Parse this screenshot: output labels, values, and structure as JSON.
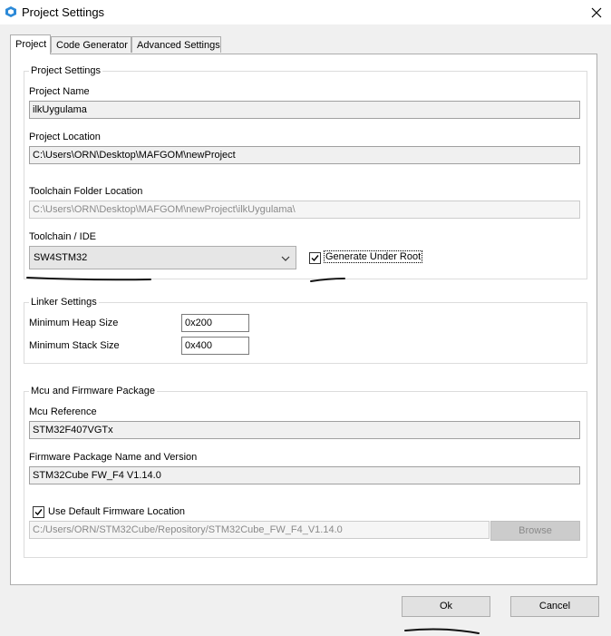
{
  "window": {
    "title": "Project Settings",
    "icon": "app-cube-icon"
  },
  "tabs": [
    {
      "label": "Project",
      "active": true
    },
    {
      "label": "Code Generator",
      "active": false
    },
    {
      "label": "Advanced Settings",
      "active": false
    }
  ],
  "project_settings": {
    "group_label": "Project Settings",
    "project_name_label": "Project Name",
    "project_name_value": "ilkUygulama",
    "project_location_label": "Project Location",
    "project_location_value": "C:\\Users\\ORN\\Desktop\\MAFGOM\\newProject",
    "toolchain_folder_label": "Toolchain Folder Location",
    "toolchain_folder_value": "C:\\Users\\ORN\\Desktop\\MAFGOM\\newProject\\ilkUygulama\\",
    "toolchain_ide_label": "Toolchain / IDE",
    "toolchain_ide_value": "SW4STM32",
    "generate_under_root_label": "Generate Under Root",
    "generate_under_root_checked": true
  },
  "linker_settings": {
    "group_label": "Linker Settings",
    "min_heap_label": "Minimum Heap Size",
    "min_heap_value": "0x200",
    "min_stack_label": "Minimum Stack Size",
    "min_stack_value": "0x400"
  },
  "mcu_firmware": {
    "group_label": "Mcu and Firmware Package",
    "mcu_reference_label": "Mcu Reference",
    "mcu_reference_value": "STM32F407VGTx",
    "firmware_package_label": "Firmware Package Name and Version",
    "firmware_package_value": "STM32Cube FW_F4 V1.14.0",
    "use_default_location_label": "Use Default Firmware Location",
    "use_default_location_checked": true,
    "firmware_location_value": "C:/Users/ORN/STM32Cube/Repository/STM32Cube_FW_F4_V1.14.0",
    "browse_label": "Browse"
  },
  "footer": {
    "ok_label": "Ok",
    "cancel_label": "Cancel"
  },
  "colors": {
    "accent": "#1e90ff",
    "window_bg": "#f0f0f0",
    "panel_bg": "#ffffff"
  }
}
